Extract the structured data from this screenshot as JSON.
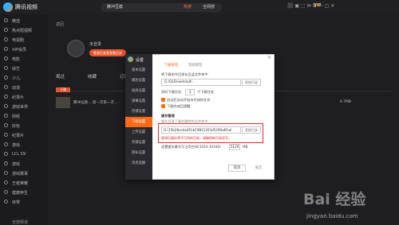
{
  "app": {
    "title": "腾讯视频"
  },
  "search": {
    "query": "腾冲豆腐",
    "hot_label": "热搜",
    "button": "全网搜"
  },
  "topbar": {
    "icons": "⬛ ▣ ⬚ ✉ ☰ — ▢ ✕",
    "vip": "VIP"
  },
  "sidebar": {
    "items": [
      "精选",
      "热点短视频",
      "电视剧",
      "VIP会员",
      "电影",
      "综艺",
      "少儿",
      "动漫",
      "纪录片",
      "游戏世界",
      "财经",
      "好玩",
      "纪录片",
      "游戏",
      "LCL S9",
      "游戏",
      "游戏赛事",
      "王者荣耀",
      "健康养生",
      "体育"
    ],
    "bottom": "全部频道"
  },
  "main": {
    "back": "返回",
    "user_name": "未登录",
    "login_button": "登录后查看观看历史",
    "tabs": [
      "观过",
      "收藏",
      "订阅"
    ],
    "list_tag": "下载",
    "row_title": "腾冲豆腐… 第一次第一次 …",
    "row_size": "6.7MB"
  },
  "dialog": {
    "title": "设置",
    "nav": [
      "基本设置",
      "播放设置",
      "画质设置",
      "弹幕设置",
      "热键设置",
      "下载设置",
      "上传设置",
      "热键设置",
      "隐私设置",
      "消息提醒"
    ],
    "active_nav": "下载设置",
    "close": "✕",
    "tab_a": "下载管理",
    "tab_b": "游戏管理",
    "label_path": "将下载的节目保存至此文件夹中",
    "path_value": "G:\\QLDownload\\",
    "browse": "更换目录",
    "count_prefix": "同时下载任务",
    "count_value": "3",
    "count_suffix": "个下载任务",
    "check1": "启动后自动开始未完成的任务",
    "check2": "下载完成后提醒",
    "cache_heading": "缓存管理",
    "cache_label": "缓存目录下载时删除的文件夹中",
    "cache_value": "G:\\75b28ce4a261b19811203d5290a6fcal",
    "cache_warn": "更改后缓存将不可用的目录，请确保新目录读写。",
    "cache_size_label": "设置缓存最大可占用空间(1024-10240)",
    "cache_size_value": "5120",
    "cache_size_unit": "MB",
    "cancel": "取消",
    "ok": "确定"
  },
  "watermark": {
    "logo": "Bai 经验",
    "url": "jingyan.baidu.com"
  }
}
